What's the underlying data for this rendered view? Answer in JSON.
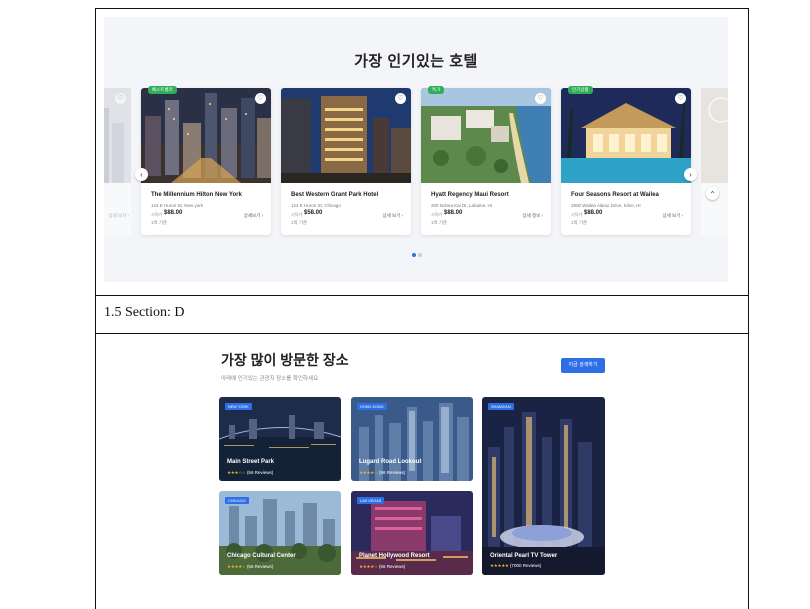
{
  "hotels_section": {
    "title": "가장 인기있는 호텔",
    "hotels": [
      {
        "badge": "베스트셀러",
        "name": "The Millennium Hilton New York",
        "address": "124 E Huron St, New york",
        "price_label": "시작가",
        "price": "$88.00",
        "per": "1박 기준",
        "detail": "상세보기 ›"
      },
      {
        "badge": "",
        "name": "Best Western Grant Park Hotel",
        "address": "124 E Huron St, Chicago",
        "price_label": "시작가",
        "price": "$58.00",
        "per": "1박 기준",
        "detail": "상세 보기 ›"
      },
      {
        "badge": "특가",
        "name": "Hyatt Regency Maui Resort",
        "address": "200 Nohea Kai Dr, Lahaina, HI",
        "price_label": "시작가",
        "price": "$88.00",
        "per": "1박 기준",
        "detail": "상세 정보 ›"
      },
      {
        "badge": "인기상품",
        "name": "Four Seasons Resort at Wailea",
        "address": "3900 Wailea Alanui Drive, Kihei, HI",
        "price_label": "시작가",
        "price": "$88.00",
        "per": "1박 기준",
        "detail": "상세 보기 ›"
      }
    ],
    "left_peek": {
      "detail": "상세 보기 ›"
    },
    "prev_icon": "‹",
    "next_icon": "›",
    "up_icon": "⌃",
    "heart_icon": "♡"
  },
  "section_label": "1.5 Section: D",
  "places_section": {
    "title": "가장 많이 방문한 장소",
    "subtitle": "아래에 인기있는 관광지 장소를 확인하세요",
    "cta": "지금 검색하기",
    "places": [
      {
        "tag": "NEW YORK",
        "name": "Main Street Park",
        "stars": "★★★☆☆",
        "reviews": "(56 Reviews)"
      },
      {
        "tag": "HONG KONG",
        "name": "Lugard Road Lookout",
        "stars": "★★★★☆",
        "reviews": "(56 Reviews)"
      },
      {
        "tag": "SHANGHAI",
        "name": "Oriental Pearl TV Tower",
        "stars": "★★★★★",
        "reviews": "(7000 Reviews)"
      },
      {
        "tag": "CHICAGO",
        "name": "Chicago Cultural Center",
        "stars": "★★★★☆",
        "reviews": "(56 Reviews)"
      },
      {
        "tag": "LAS VEGAS",
        "name": "Planet Hollywood Resort",
        "stars": "★★★★☆",
        "reviews": "(56 Reviews)"
      }
    ]
  },
  "colors": {
    "accent": "#2f6fe6",
    "badge_green": "#2fae5a",
    "star": "#f3b21c"
  }
}
